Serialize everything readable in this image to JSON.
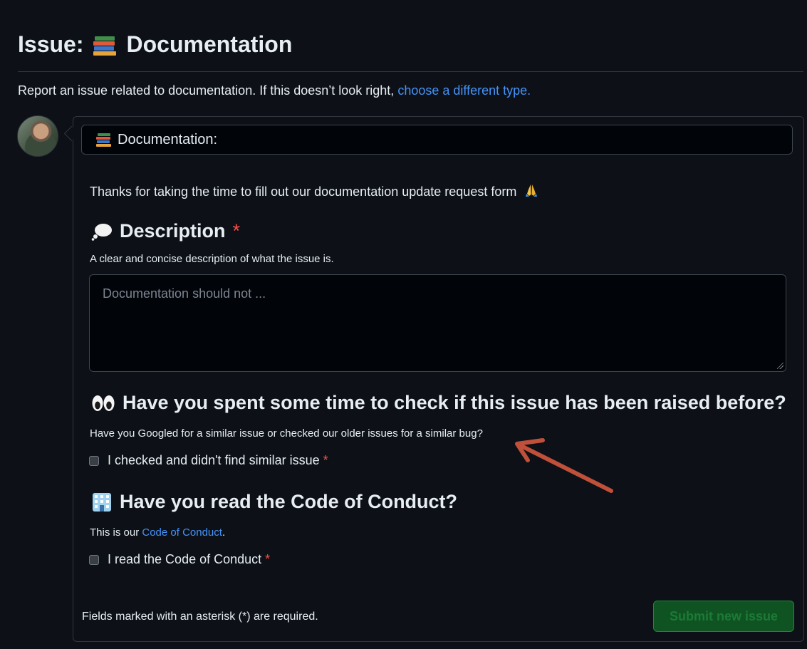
{
  "header": {
    "prefix": "Issue:",
    "title": "Documentation",
    "subtitle": "Report an issue related to documentation. If this doesn’t look right,",
    "change_type_link": "choose a different type."
  },
  "form": {
    "title_value": "Documentation:",
    "intro": "Thanks for taking the time to fill out our documentation update request form",
    "description": {
      "heading": "Description",
      "help": "A clear and concise description of what the issue is.",
      "placeholder": "Documentation should not ..."
    },
    "duplicate_check": {
      "heading": "Have you spent some time to check if this issue has been raised before?",
      "help": "Have you Googled for a similar issue or checked our older issues for a similar bug?",
      "checkbox_label": "I checked and didn't find similar issue"
    },
    "code_of_conduct": {
      "heading": "Have you read the Code of Conduct?",
      "help_prefix": "This is our",
      "link": "Code of Conduct",
      "help_suffix": ".",
      "checkbox_label": "I read the Code of Conduct"
    },
    "required_marker": "*",
    "footer_note": "Fields marked with an asterisk (*) are required.",
    "submit_label": "Submit new issue"
  },
  "colors": {
    "background": "#0d1117",
    "link": "#4493f8",
    "required": "#f85149",
    "submit_bg": "#0f5323",
    "annotation_arrow": "#c0503a"
  },
  "icons": {
    "title": "books-icon",
    "description": "thought-bubble-icon",
    "duplicate_check": "eyes-icon",
    "code_of_conduct": "office-building-icon",
    "intro": "folded-hands-icon"
  }
}
